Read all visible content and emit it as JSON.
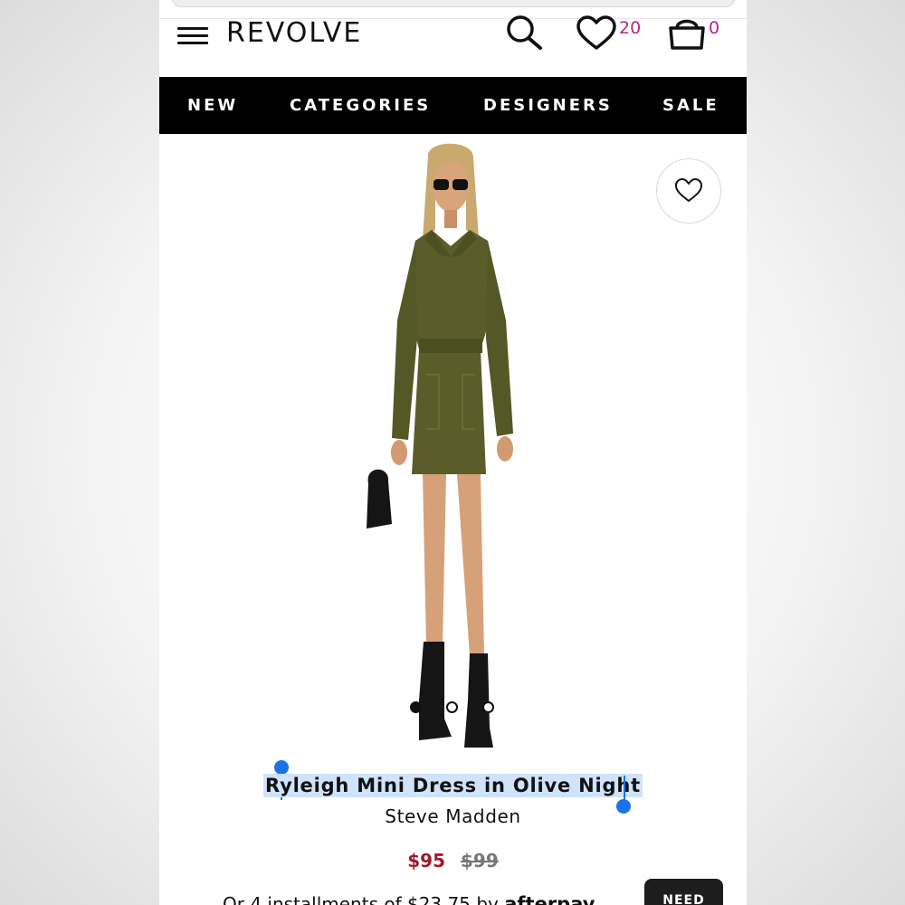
{
  "header": {
    "logo": "REVOLVE",
    "wishlist_count": "20",
    "cart_count": "0"
  },
  "nav": {
    "items": [
      "NEW",
      "CATEGORIES",
      "DESIGNERS",
      "SALE"
    ]
  },
  "product": {
    "title": "Ryleigh Mini Dress in Olive Night",
    "brand": "Steve Madden",
    "price_sale": "$95",
    "price_original": "$99",
    "installments_text": "Or 4 installments of $23.75 by",
    "installments_provider": "afterpay",
    "image_dots": {
      "count": 3,
      "active_index": 0
    }
  },
  "help_button": {
    "label": "NEED"
  },
  "colors": {
    "nav_bg": "#000000",
    "count_accent": "#b0278c",
    "sale_price": "#9b1d2a",
    "selection_highlight": "#cfe3fb",
    "selection_handle": "#1a73e8"
  },
  "icons": {
    "menu": "hamburger-icon",
    "search": "search-icon",
    "wishlist": "heart-icon",
    "cart": "shopping-bag-icon",
    "favorite": "heart-outline-icon"
  }
}
